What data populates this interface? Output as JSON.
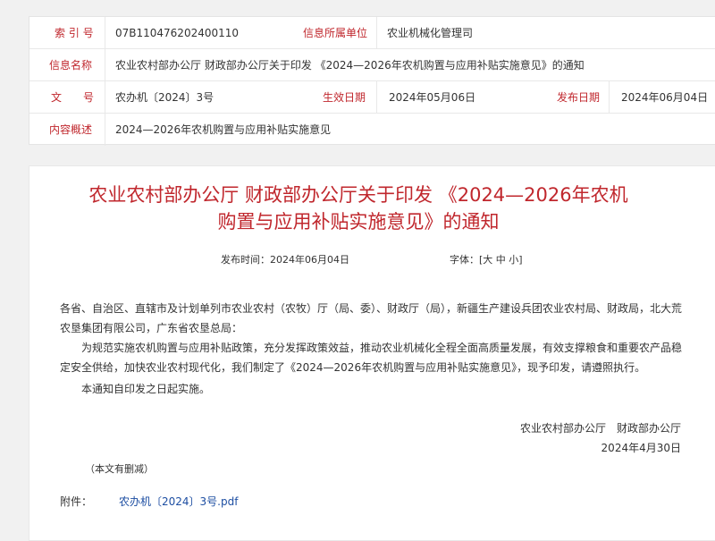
{
  "meta": {
    "index_label": "索 引 号",
    "index_value": "07B110476202400110",
    "unit_label": "信息所属单位",
    "unit_value": "农业机械化管理司",
    "name_label": "信息名称",
    "name_value": "农业农村部办公厅 财政部办公厅关于印发 《2024—2026年农机购置与应用补贴实施意见》的通知",
    "doc_label": "文　　号",
    "doc_value": "农办机〔2024〕3号",
    "effective_label": "生效日期",
    "effective_value": "2024年05月06日",
    "publish_label": "发布日期",
    "publish_value": "2024年06月04日",
    "summary_label": "内容概述",
    "summary_value": "2024—2026年农机购置与应用补贴实施意见"
  },
  "article": {
    "title_line1": "农业农村部办公厅 财政部办公厅关于印发 《2024—2026年农机",
    "title_line2": "购置与应用补贴实施意见》的通知",
    "publish_time": "发布时间：2024年06月04日",
    "font_label": "字体：",
    "font_large": "大",
    "font_medium": "中",
    "font_small": "小",
    "recipients": "各省、自治区、直辖市及计划单列市农业农村（农牧）厅（局、委）、财政厅（局），新疆生产建设兵团农业农村局、财政局，北大荒农垦集团有限公司，广东省农垦总局：",
    "paragraph1": "为规范实施农机购置与应用补贴政策，充分发挥政策效益，推动农业机械化全程全面高质量发展，有效支撑粮食和重要农产品稳定安全供给，加快农业农村现代化，我们制定了《2024—2026年农机购置与应用补贴实施意见》，现予印发，请遵照执行。",
    "paragraph2": "本通知自印发之日起实施。",
    "signature": "农业农村部办公厅　财政部办公厅",
    "sign_date": "2024年4月30日",
    "note": "（本文有删减）",
    "attachment_label": "附件：",
    "attachment_file": "农办机〔2024〕3号.pdf"
  },
  "colors": {
    "label_red": "#c0272d",
    "link_blue": "#1d4ea2"
  }
}
